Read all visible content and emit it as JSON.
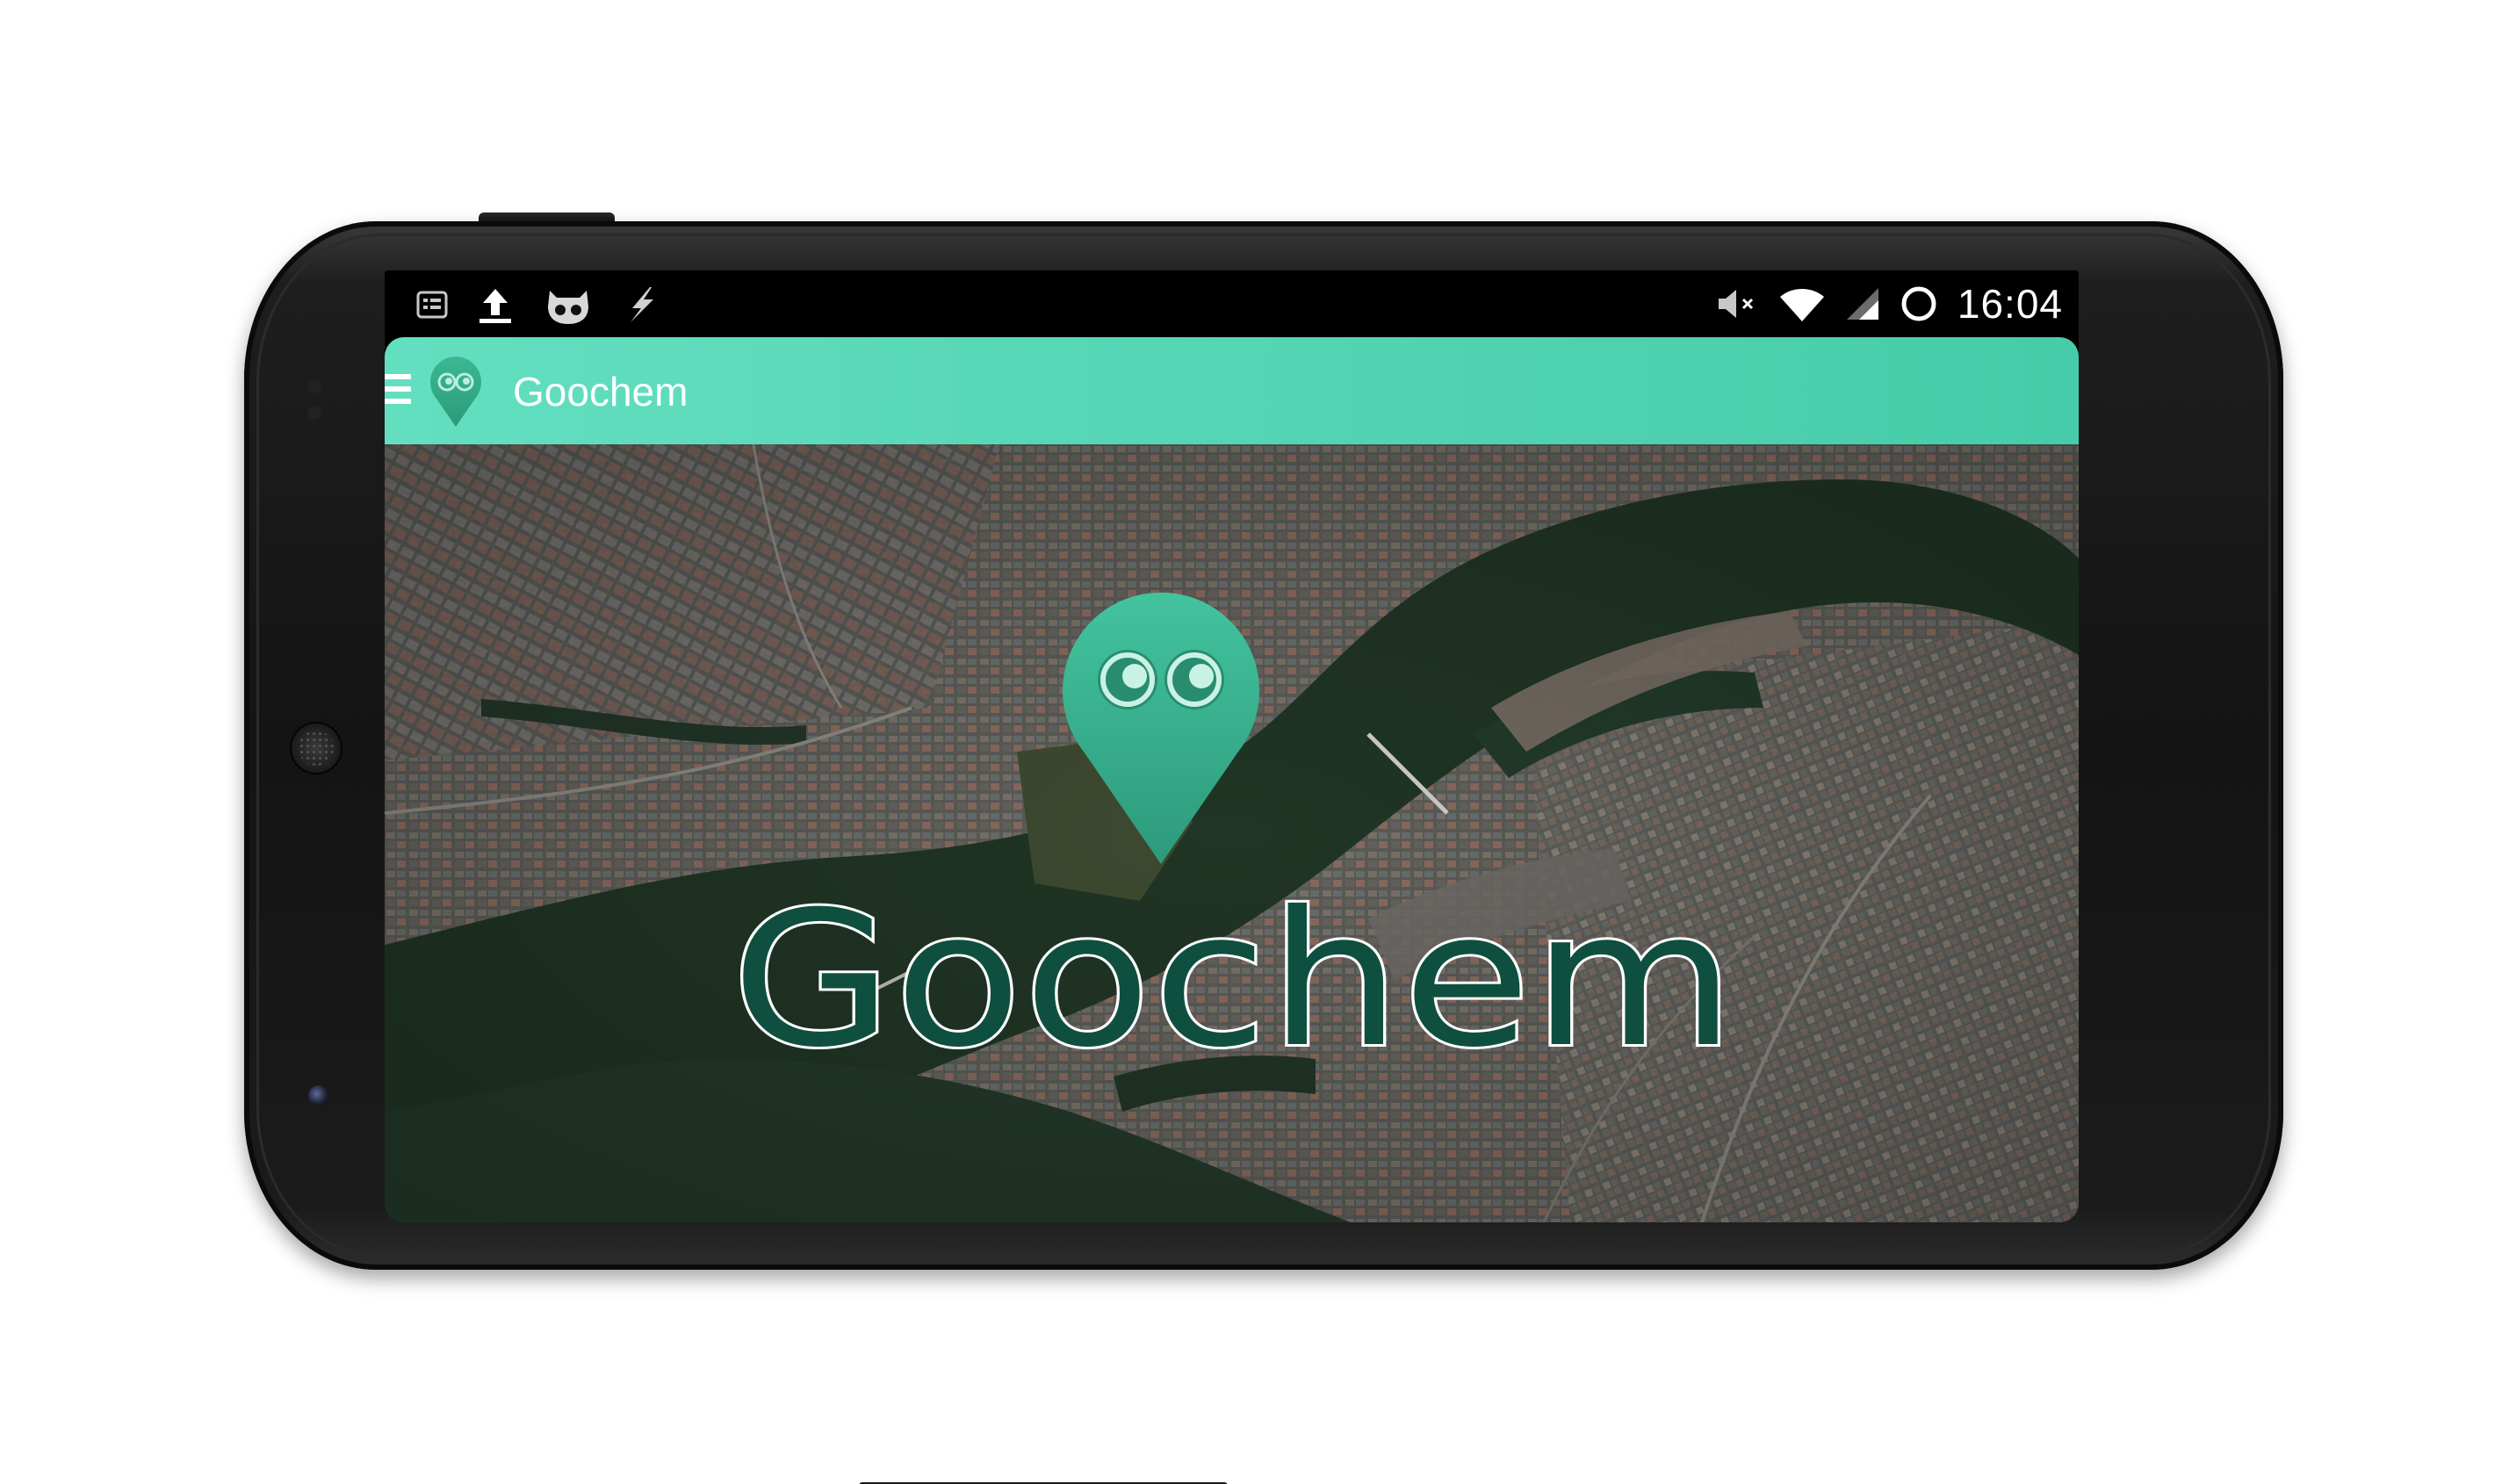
{
  "status_bar": {
    "notification_icons": [
      "notification-list-icon",
      "upload-icon",
      "cyanogenmod-mascot-icon",
      "flash-icon"
    ],
    "system_icons": [
      "volume-muted-icon",
      "wifi-icon",
      "cell-signal-icon",
      "circle-status-icon"
    ],
    "time": "16:04"
  },
  "action_bar": {
    "menu_icon": "hamburger-menu-icon",
    "app_icon": "goochem-pin-icon",
    "title": "Goochem",
    "color_start": "#63dfc0",
    "color_end": "#46cca8"
  },
  "main": {
    "background": "satellite-map-image",
    "pin_icon": "goochem-location-pin-icon",
    "logo_text": "Goochem",
    "accent_color": "#3ab795"
  }
}
